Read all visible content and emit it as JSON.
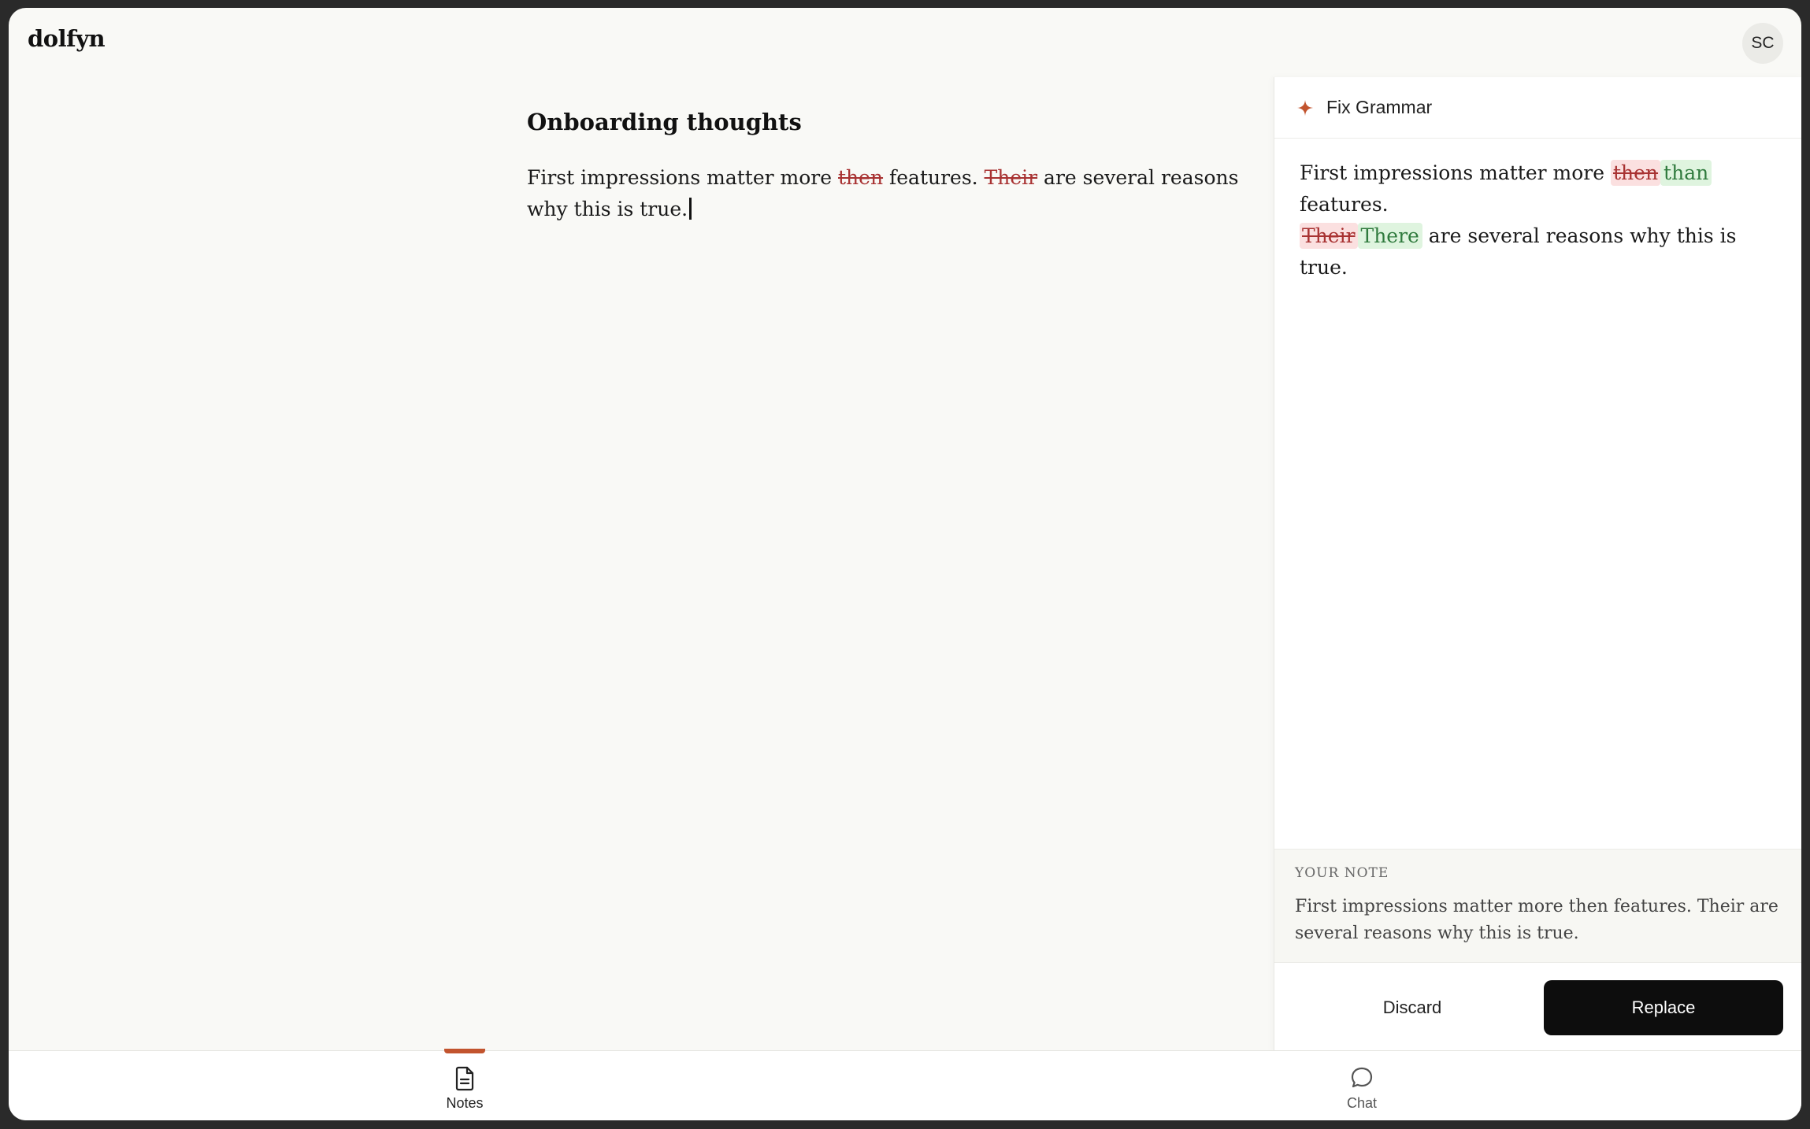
{
  "app": {
    "logo": "dolfyn",
    "avatar_initials": "SC"
  },
  "editor": {
    "title": "Onboarding thoughts",
    "body": {
      "part1": "First impressions matter more ",
      "err1": "then",
      "part2": " features. ",
      "err2": "Their",
      "part3": " are several reasons why this is true."
    }
  },
  "panel": {
    "title": "Fix Grammar",
    "icon": "sparkle-icon",
    "suggestion": {
      "part1": "First impressions matter more ",
      "del1": "then",
      "ins1": "than",
      "part2": " features. ",
      "del2": "Their",
      "ins2": "There",
      "part3": " are several reasons why this is true."
    },
    "note_label": "YOUR NOTE",
    "note_text": "First impressions matter more then features. Their are several reasons why this is true.",
    "discard_label": "Discard",
    "replace_label": "Replace"
  },
  "bottom_nav": {
    "items": [
      {
        "label": "Notes",
        "icon": "document-icon",
        "active": true
      },
      {
        "label": "Chat",
        "icon": "chat-bubble-icon",
        "active": false
      }
    ]
  },
  "colors": {
    "accent": "#c2542e",
    "deletion": "#a83232",
    "insertion": "#2f7a3d",
    "button_dark": "#0d0d0d"
  }
}
